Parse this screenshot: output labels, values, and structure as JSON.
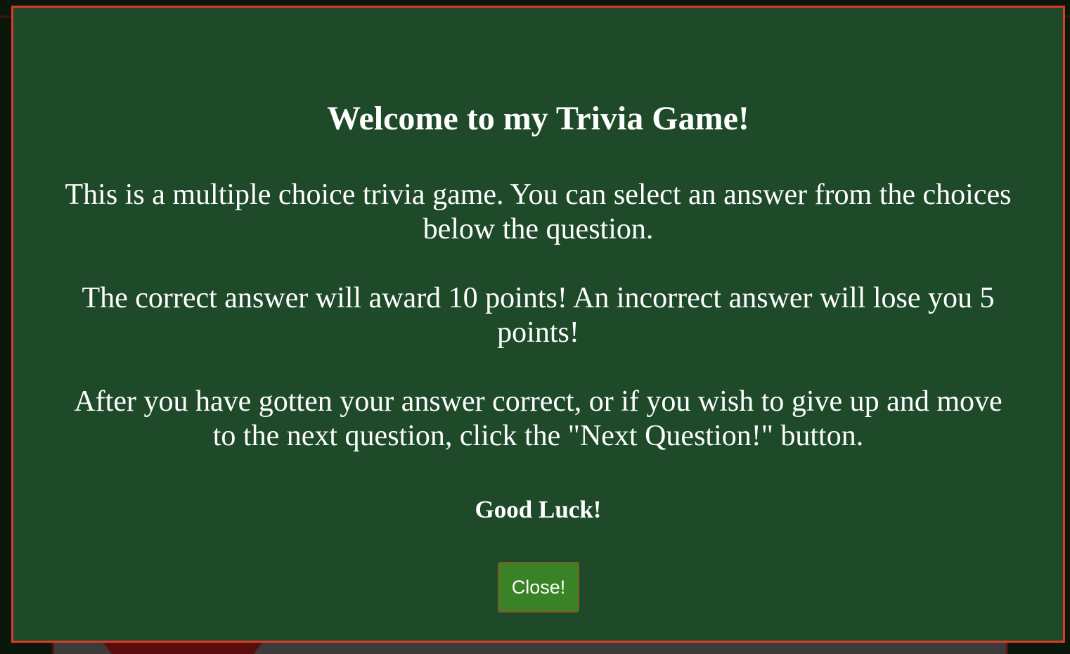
{
  "modal": {
    "title": "Welcome to my Trivia Game!",
    "paragraphs": [
      "This is a multiple choice trivia game. You can select an answer from the choices below the question.",
      "The correct answer will award 10 points! An incorrect answer will lose you 5 points!",
      "After you have gotten your answer correct, or if you wish to give up and move to the next question, click the \"Next Question!\" button."
    ],
    "closing": "Good Luck!",
    "close_label": "Close!"
  },
  "colors": {
    "modal_background": "#1e4a2a",
    "modal_border": "#d93a2b",
    "button_background": "#3a8226",
    "text": "#ffffff"
  }
}
